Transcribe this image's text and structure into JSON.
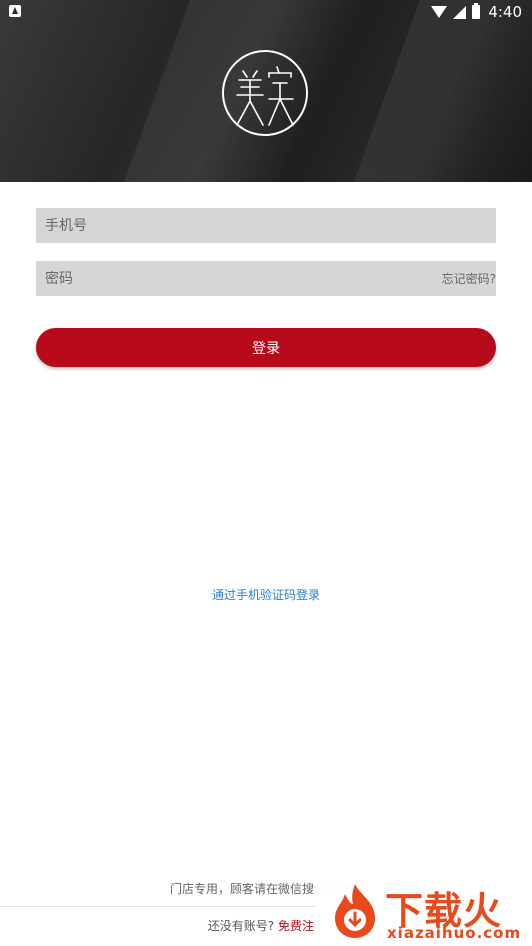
{
  "status_bar": {
    "time": "4:40",
    "icons": [
      "notification-icon",
      "wifi-icon",
      "signal-icon",
      "battery-icon"
    ]
  },
  "header": {
    "logo": "美 logo"
  },
  "form": {
    "phone_placeholder": "手机号",
    "password_placeholder": "密码",
    "forgot_password": "忘记密码?",
    "login_button": "登录"
  },
  "sms_login_link": "通过手机验证码登录",
  "footer": {
    "store_note": "门店专用，顾客请在微信搜索「预约",
    "no_account": "还没有账号?",
    "register": "免费注"
  },
  "watermark": {
    "title": "下载火",
    "domain": "xiazaihuo.com"
  },
  "colors": {
    "accent": "#b70b1c",
    "link": "#2a7ec9",
    "field_bg": "#d6d6d6",
    "header_bg": "#262626",
    "watermark": "#e8491d"
  }
}
